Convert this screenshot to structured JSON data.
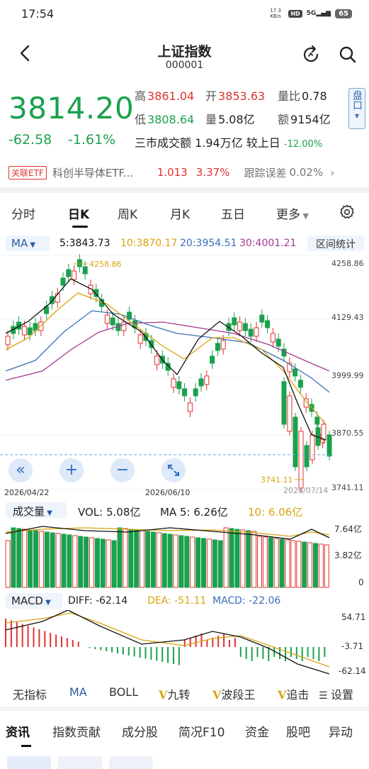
{
  "status": {
    "time": "17:54",
    "net_speed": "17.3 KB/s",
    "hd": "HD",
    "signal": "5G",
    "battery": "65"
  },
  "header": {
    "title": "上证指数",
    "code": "000001",
    "icons": [
      "back-arrow-icon",
      "refresh-icon",
      "search-icon"
    ]
  },
  "quote": {
    "price": "3814.20",
    "change": "-62.58",
    "change_pct": "-1.61%",
    "high_label": "高",
    "high": "3861.04",
    "open_label": "开",
    "open": "3853.63",
    "ratio_label": "量比",
    "ratio": "0.78",
    "low_label": "低",
    "low": "3808.64",
    "vol_label": "量",
    "vol": "5.08亿",
    "amt_label": "额",
    "amt": "9154亿",
    "market_line": "三市成交额 1.94万亿 较上日",
    "market_change": "-12.00%",
    "pankou": "盘口"
  },
  "etf": {
    "tag": "关联ETF",
    "name": "科创半导体ETF...",
    "price": "1.013",
    "pct": "3.37%",
    "tracking_label": "跟踪误差",
    "tracking": "0.02%"
  },
  "tabs": [
    "分时",
    "日K",
    "周K",
    "月K",
    "五日",
    "更多"
  ],
  "active_tab": "日K",
  "ma": {
    "button": "MA",
    "ma5": "5:3843.73",
    "ma10": "10:3870.17",
    "ma20": "20:3954.51",
    "ma30": "30:4001.21",
    "stat_button": "区间统计"
  },
  "kline": {
    "y_labels": [
      "4258.86",
      "4129.43",
      "3999.99",
      "3870.55",
      "3741.11"
    ],
    "high_marker": "4258.86",
    "low_marker": "3741.11",
    "dates": [
      "2026/04/22",
      "2026/06/10",
      "2026/07/14"
    ],
    "colors": {
      "up": "#e0322f",
      "down": "#1aa14e",
      "ma5": "#111111",
      "ma10": "#d9a30f",
      "ma20": "#3c6fb5",
      "ma30": "#a23a8f"
    }
  },
  "zoom": {
    "prev": "«",
    "plus": "+",
    "minus": "−"
  },
  "volume": {
    "button": "成交量",
    "vol": "VOL: 5.08亿",
    "ma5": "MA 5: 6.26亿",
    "ma10": "10: 6.06亿",
    "y_labels": [
      "7.64亿",
      "3.82亿",
      "0"
    ]
  },
  "macd": {
    "button": "MACD",
    "diff": "DIFF: -62.14",
    "dea": "DEA: -51.11",
    "macd": "MACD: -22.06",
    "y_labels": [
      "54.71",
      "-3.71",
      "-62.14"
    ]
  },
  "indicators": [
    "无指标",
    "MA",
    "BOLL",
    "九转",
    "波段王",
    "追击",
    "设置"
  ],
  "indicator_prefix": "V",
  "bottom_tabs": [
    "资讯",
    "指数贡献",
    "成分股",
    "简况F10",
    "资金",
    "股吧",
    "异动"
  ]
}
